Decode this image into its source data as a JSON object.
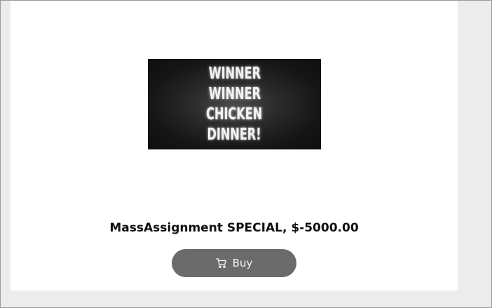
{
  "product": {
    "banner_lines": [
      "WINNER",
      "WINNER",
      "CHICKEN",
      "DINNER!"
    ],
    "title": "MassAssignment SPECIAL, $-5000.00",
    "buy_label": "Buy",
    "buy_icon": "shopping-cart-icon"
  },
  "colors": {
    "page_background": "#ececec",
    "card_background": "#ffffff",
    "button_background": "#6b6b6b",
    "button_text": "#f4f4f4",
    "banner_background": "#161616"
  }
}
